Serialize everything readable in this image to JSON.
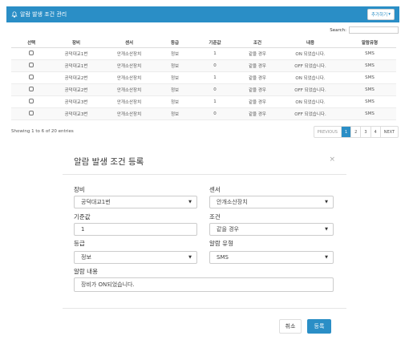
{
  "panel": {
    "title": "알람 발생 조건 관리",
    "add_button": "추가하기",
    "search_label": "Search:",
    "search_value": ""
  },
  "table": {
    "headers": [
      "선택",
      "장비",
      "센서",
      "등급",
      "기준값",
      "조건",
      "내용",
      "알람유형"
    ],
    "rows": [
      [
        "공덕대교1번",
        "안개소산장치",
        "정보",
        "1",
        "같을 경우",
        "ON 되었습니다.",
        "SMS"
      ],
      [
        "공덕대교1번",
        "안개소산장치",
        "정보",
        "0",
        "같을 경우",
        "OFF 되었습니다.",
        "SMS"
      ],
      [
        "공덕대교2번",
        "안개소산장치",
        "정보",
        "1",
        "같을 경우",
        "ON 되었습니다.",
        "SMS"
      ],
      [
        "공덕대교2번",
        "안개소산장치",
        "정보",
        "0",
        "같을 경우",
        "OFF 되었습니다.",
        "SMS"
      ],
      [
        "공덕대교3번",
        "안개소산장치",
        "정보",
        "1",
        "같을 경우",
        "ON 되었습니다.",
        "SMS"
      ],
      [
        "공덕대교3번",
        "안개소산장치",
        "정보",
        "0",
        "같을 경우",
        "OFF 되었습니다.",
        "SMS"
      ]
    ]
  },
  "footer": {
    "info": "Showing 1 to 6 of 20 entries",
    "pager": [
      "PREVIOUS",
      "1",
      "2",
      "3",
      "4",
      "NEXT"
    ],
    "active_page": "1"
  },
  "modal": {
    "title": "알람 발생 조건 등록",
    "close": "×",
    "equipment_label": "장비",
    "equipment_value": "공덕대교1번",
    "sensor_label": "센서",
    "sensor_value": "안개소산장치",
    "threshold_label": "기준값",
    "threshold_value": "1",
    "condition_label": "조건",
    "condition_value": "같을 경우",
    "grade_label": "등급",
    "grade_value": "정보",
    "alarm_type_label": "알람 유형",
    "alarm_type_value": "SMS",
    "content_label": "알람 내용",
    "content_value": "장비가 ON되었습니다.",
    "cancel_button": "취소",
    "submit_button": "등록"
  },
  "colors": {
    "accent": "#2a8ec6"
  },
  "icons": {
    "header_icon": "bell-icon",
    "caret": "caret-down-icon",
    "checkbox": "checkbox-icon"
  }
}
